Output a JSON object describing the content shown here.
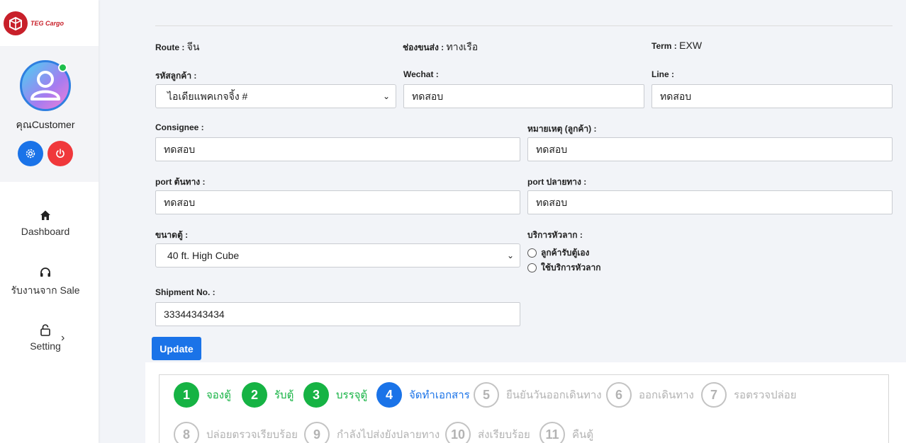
{
  "brand": {
    "name": "TEG Cargo",
    "color": "#c8202a"
  },
  "user": {
    "name": "คุณCustomer",
    "online": true
  },
  "nav": {
    "items": [
      {
        "label": "Dashboard",
        "icon": "home-icon"
      },
      {
        "label": "รับงานจาก Sale",
        "icon": "headset-icon"
      },
      {
        "label": "Setting",
        "icon": "lock-icon"
      }
    ]
  },
  "info": {
    "route_label": "Route :",
    "route_value": "จีน",
    "transport_label": "ช่องขนส่ง :",
    "transport_value": "ทางเรือ",
    "term_label": "Term :",
    "term_value": "EXW"
  },
  "form": {
    "customer_code_label": "รหัสลูกค้า :",
    "customer_code_value": "ไอเดียแพคเกจจิ้ง #",
    "wechat_label": "Wechat :",
    "wechat_value": "ทดสอบ",
    "line_label": "Line :",
    "line_value": "ทดสอบ",
    "consignee_label": "Consignee :",
    "consignee_value": "ทดสอบ",
    "note_label": "หมายเหตุ (ลูกค้า) :",
    "note_value": "ทดสอบ",
    "port_origin_label": "port ต้นทาง :",
    "port_origin_value": "ทดสอบ",
    "port_dest_label": "port ปลายทาง :",
    "port_dest_value": "ทดสอบ",
    "container_label": "ขนาดตู้ :",
    "container_value": "40 ft. High Cube",
    "trucking_label": "บริการหัวลาก :",
    "trucking_options": [
      "ลูกค้ารับตู้เอง",
      "ใช้บริการหัวลาก"
    ],
    "shipment_label": "Shipment No. :",
    "shipment_value": "33344343434",
    "update_label": "Update"
  },
  "steps": [
    {
      "num": "1",
      "label": "จองตู้",
      "state": "done"
    },
    {
      "num": "2",
      "label": "รับตู้",
      "state": "done"
    },
    {
      "num": "3",
      "label": "บรรจุตู้",
      "state": "done"
    },
    {
      "num": "4",
      "label": "จัดทำเอกสาร",
      "state": "active"
    },
    {
      "num": "5",
      "label": "ยืนยันวันออกเดินทาง",
      "state": "todo"
    },
    {
      "num": "6",
      "label": "ออกเดินทาง",
      "state": "todo"
    },
    {
      "num": "7",
      "label": "รอตรวจปล่อย",
      "state": "todo"
    },
    {
      "num": "8",
      "label": "ปล่อยตรวจเรียบร้อย",
      "state": "todo"
    },
    {
      "num": "9",
      "label": "กำลังไปส่งยังปลายทาง",
      "state": "todo"
    },
    {
      "num": "10",
      "label": "ส่งเรียบร้อย",
      "state": "todo"
    },
    {
      "num": "11",
      "label": "คืนตู้",
      "state": "todo"
    }
  ],
  "colors": {
    "primary": "#1a73e8",
    "success": "#16b344",
    "danger": "#f0383b",
    "muted": "#b3b3b3"
  }
}
